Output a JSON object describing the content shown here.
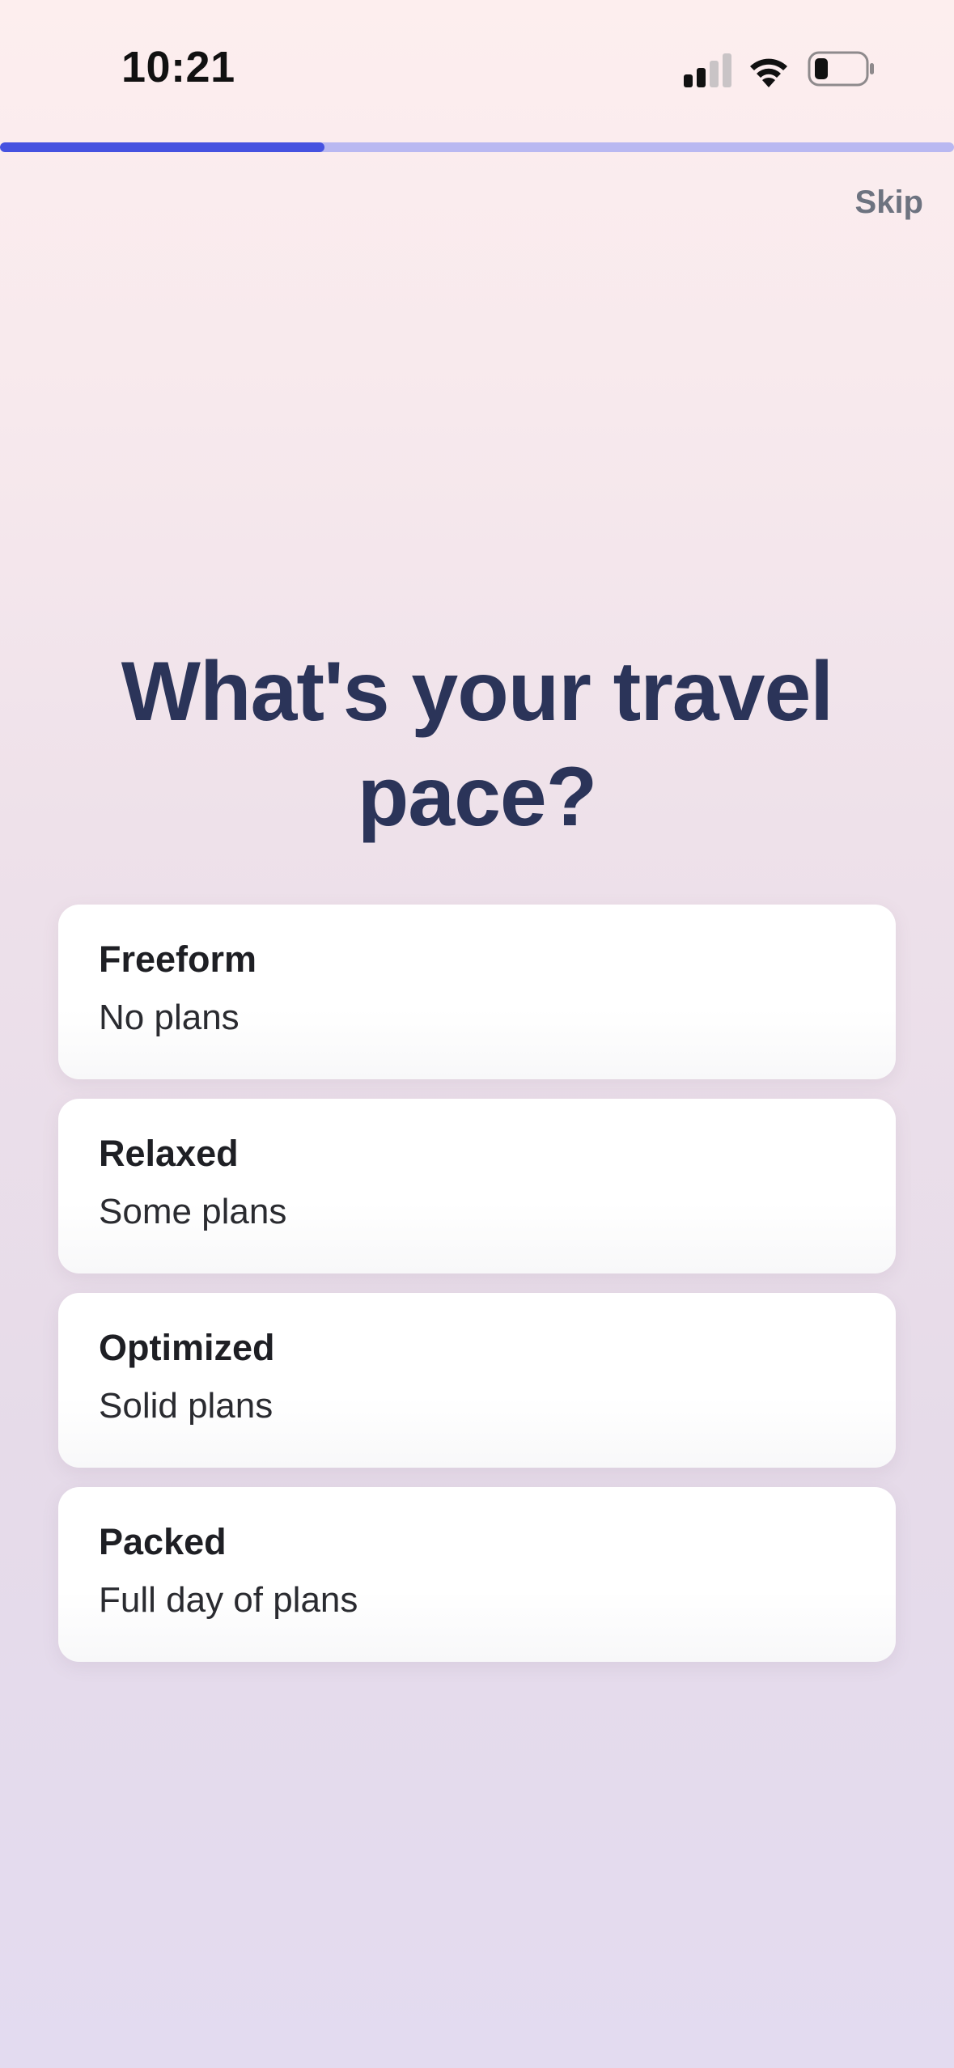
{
  "status_bar": {
    "time": "10:21",
    "icons": [
      "cellular-signal-icon",
      "wifi-icon",
      "battery-icon"
    ]
  },
  "progress": {
    "fraction": 0.34,
    "fill_color": "#4652e0",
    "track_color": "#b9b8f1"
  },
  "header": {
    "skip_label": "Skip"
  },
  "question": {
    "title": "What's your travel pace?"
  },
  "options": [
    {
      "title": "Freeform",
      "subtitle": "No plans"
    },
    {
      "title": "Relaxed",
      "subtitle": "Some plans"
    },
    {
      "title": "Optimized",
      "subtitle": "Solid plans"
    },
    {
      "title": "Packed",
      "subtitle": "Full day of plans"
    }
  ],
  "colors": {
    "title": "#2b3459",
    "skip": "#6d7380",
    "card": "#ffffff"
  }
}
